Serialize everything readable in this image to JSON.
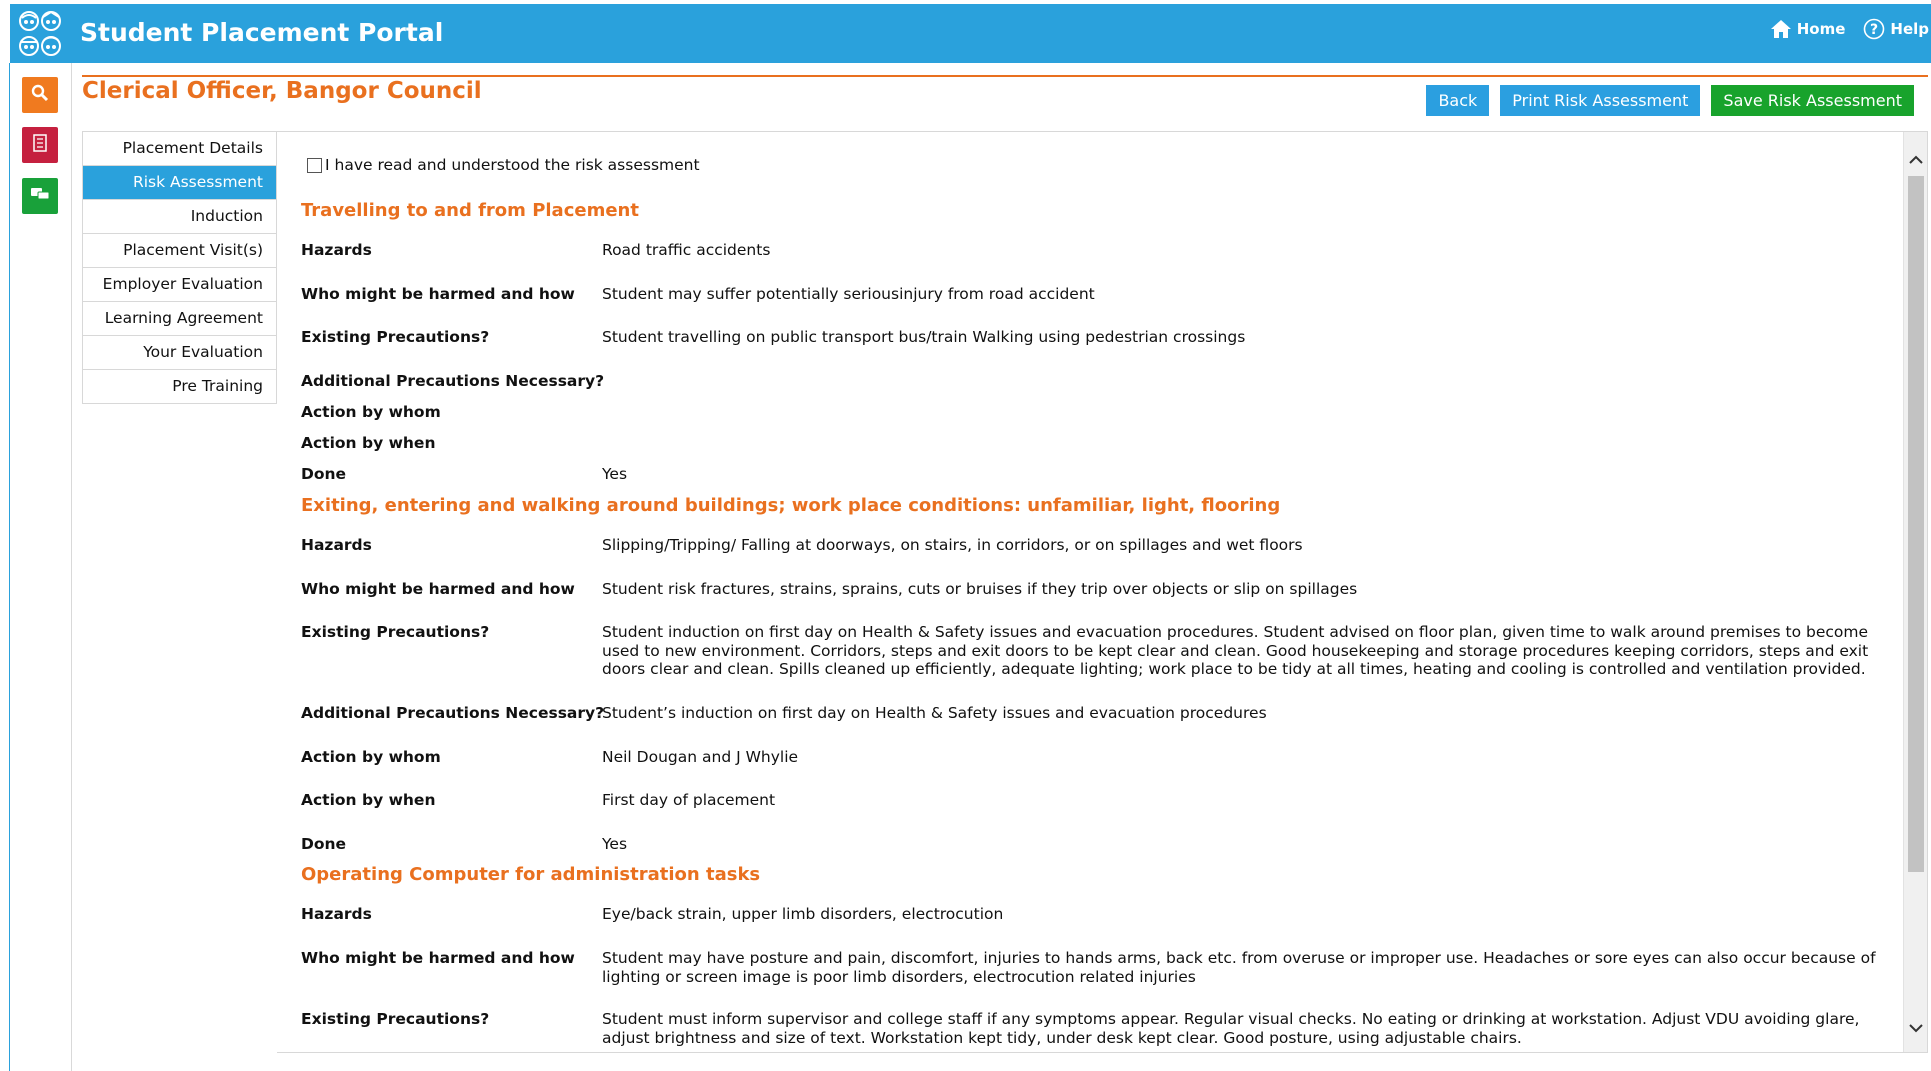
{
  "app": {
    "title": "Student Placement Portal",
    "home_label": "Home",
    "help_label": "Help"
  },
  "rail": {
    "icons": [
      "search-icon",
      "checklist-icon",
      "chat-icon"
    ],
    "colors": {
      "search": "#f07a1f",
      "checklist": "#c5203f",
      "chat": "#19a13a"
    }
  },
  "page": {
    "title": "Clerical Officer, Bangor Council"
  },
  "actions": {
    "back": "Back",
    "print": "Print Risk Assessment",
    "save": "Save Risk Assessment"
  },
  "tabs": [
    "Placement Details",
    "Risk Assessment",
    "Induction",
    "Placement Visit(s)",
    "Employer Evaluation",
    "Learning Agreement",
    "Your Evaluation",
    "Pre Training"
  ],
  "active_tab": "Risk Assessment",
  "ack": {
    "label": "I have read and understood the risk assessment",
    "checked": false
  },
  "sections": [
    {
      "title": "Travelling to and from Placement",
      "rows": [
        {
          "label": "Hazards",
          "value": "Road traffic accidents"
        },
        {
          "label": "Who might be harmed and how",
          "value": "Student may suffer potentially seriousinjury from road accident"
        },
        {
          "label": "Existing Precautions?",
          "value": "Student travelling on public transport bus/train Walking using pedestrian crossings"
        },
        {
          "label": "Additional Precautions Necessary?",
          "value": ""
        },
        {
          "label": "Action by whom",
          "value": ""
        },
        {
          "label": "Action by when",
          "value": ""
        },
        {
          "label": "Done",
          "value": "Yes"
        }
      ]
    },
    {
      "title": "Exiting, entering and walking around buildings; work place conditions: unfamiliar, light, flooring",
      "rows": [
        {
          "label": "Hazards",
          "value": "Slipping/Tripping/ Falling at doorways, on stairs, in corridors, or on spillages and wet floors"
        },
        {
          "label": "Who might be harmed and how",
          "value": "Student risk fractures, strains, sprains, cuts or bruises if they trip over objects or slip on spillages"
        },
        {
          "label": "Existing Precautions?",
          "value": "Student induction on first day on Health & Safety issues and evacuation procedures. Student advised on floor plan, given time to walk around premises to become used to new environment. Corridors, steps and exit doors to be kept clear and clean. Good housekeeping and storage procedures keeping corridors, steps and exit doors clear and clean. Spills cleaned up efficiently, adequate lighting; work place to be tidy at all times, heating and cooling is controlled and ventilation provided."
        },
        {
          "label": "Additional Precautions Necessary?",
          "value": "Student’s induction on first day on Health & Safety issues and evacuation procedures"
        },
        {
          "label": "Action by whom",
          "value": "Neil Dougan and J Whylie"
        },
        {
          "label": "Action by when",
          "value": "First day of placement"
        },
        {
          "label": "Done",
          "value": "Yes"
        }
      ]
    },
    {
      "title": "Operating Computer for administration tasks",
      "rows": [
        {
          "label": "Hazards",
          "value": "Eye/back strain, upper limb disorders, electrocution"
        },
        {
          "label": "Who might be harmed and how",
          "value": "Student may have posture and pain, discomfort, injuries to hands arms, back etc. from overuse or improper use. Headaches or sore eyes can also occur because of lighting or screen image is poor limb disorders, electrocution related injuries"
        },
        {
          "label": "Existing Precautions?",
          "value": "Student must inform supervisor and college staff if any symptoms appear. Regular visual checks. No eating or drinking at workstation. Adjust VDU avoiding glare, adjust brightness and size of text. Workstation kept tidy, under desk kept clear. Good posture, using adjustable chairs."
        }
      ]
    }
  ],
  "colors": {
    "header": "#2aa1dc",
    "accent": "#e9701f",
    "button_blue": "#2b9fe0",
    "button_green": "#18a32c"
  }
}
